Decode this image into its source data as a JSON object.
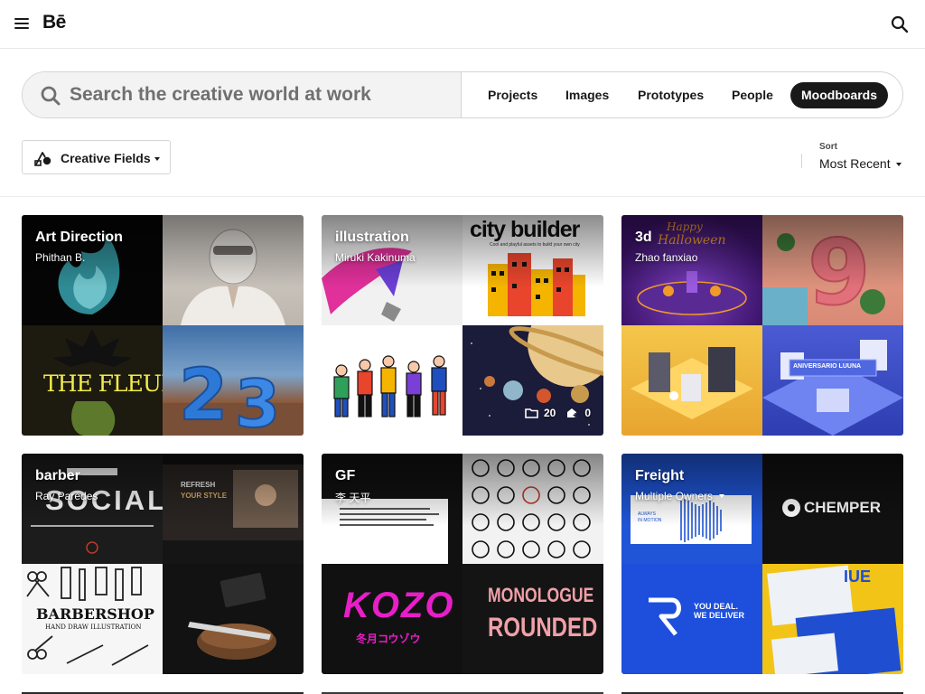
{
  "header": {
    "logo": "Bē"
  },
  "search": {
    "placeholder": "Search the creative world at work"
  },
  "tabs": [
    {
      "label": "Projects",
      "active": false
    },
    {
      "label": "Images",
      "active": false
    },
    {
      "label": "Prototypes",
      "active": false
    },
    {
      "label": "People",
      "active": false
    },
    {
      "label": "Moodboards",
      "active": true
    }
  ],
  "filters": {
    "creative_fields_label": "Creative Fields",
    "sort_caption": "Sort",
    "sort_value": "Most Recent"
  },
  "boards": [
    {
      "title": "Art Direction",
      "owner": "Phithan B.",
      "tile_texts": [
        "THE FLEUR"
      ]
    },
    {
      "title": "illustration",
      "owner": "Miruki Kakinuma",
      "tile_texts": [
        "city builder",
        "Cool and playful assets to build your own city"
      ],
      "stats": {
        "projects": "20",
        "followers": "0"
      }
    },
    {
      "title": "3d",
      "owner": "Zhao fanxiao",
      "tile_texts": [
        "Happy",
        "Halloween",
        "ANIVERSARIO LUUNA"
      ]
    },
    {
      "title": "barber",
      "owner": "Ray Paredes",
      "tile_texts": [
        "SOCIAL",
        "REFRESH",
        "YOUR STYLE",
        "BARBERSHOP",
        "HAND DRAW ILLUSTRATION"
      ]
    },
    {
      "title": "GF",
      "owner": "李 天平",
      "tile_texts": [
        "KOZO",
        "冬月コウゾウ",
        "MONOLOGUE",
        "ROUNDED"
      ]
    },
    {
      "title": "Freight",
      "owner": "Multiple Owners",
      "tile_texts": [
        "ALWAYS",
        "IN MOTION",
        "CHEMPER",
        "YOU DEAL.",
        "WE DELIVER",
        "IUE"
      ]
    }
  ],
  "colors": {
    "accent_dark": "#191919",
    "board_bg_art": "#0c0c0c",
    "board_bg_illustration": "#f0f0f0",
    "board_bg_3d": "#4a1a7a",
    "board_bg_barber": "#1f1f1f",
    "board_bg_gf": "#141414",
    "board_bg_freight": "#1d4ed8"
  }
}
